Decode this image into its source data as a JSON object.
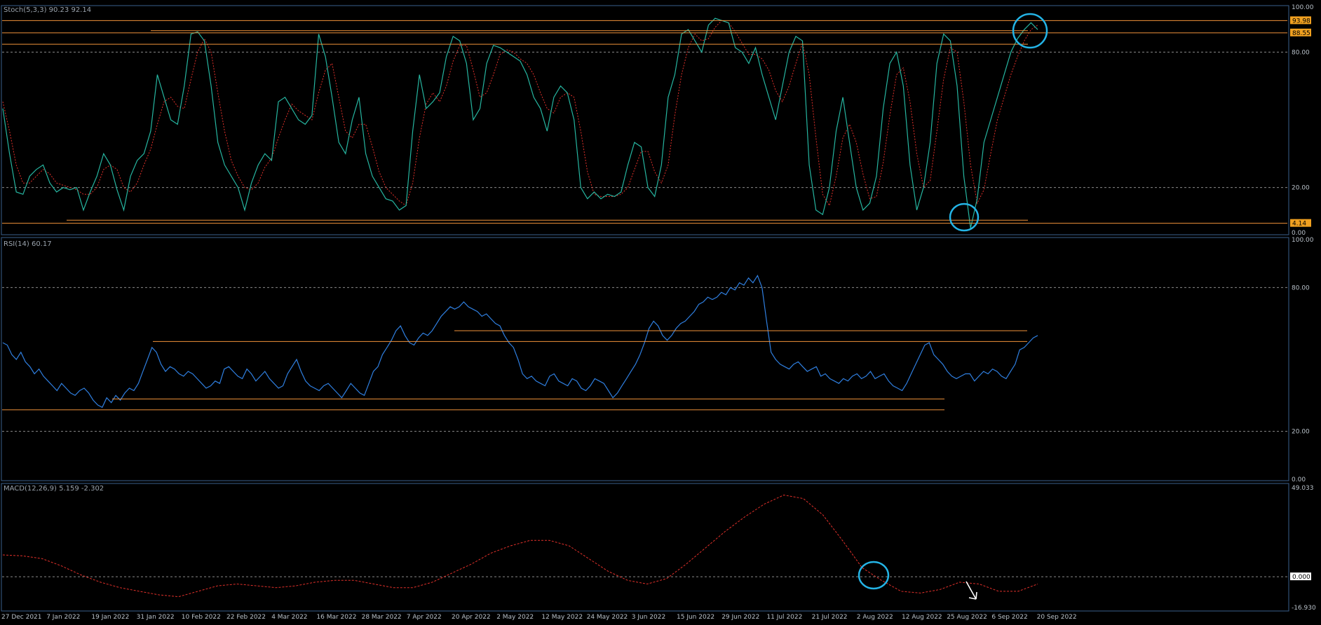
{
  "colors": {
    "background": "#000000",
    "panel_border": "#3a5f8c",
    "grid": "#8a8a8a",
    "stoch_main": "#26b5a0",
    "stoch_signal": "#e0302a",
    "rsi": "#2f7fe0",
    "macd_signal": "#e0302a",
    "level_line": "#f0923a",
    "highlight": "#24b4e6",
    "arrow": "#ffffff",
    "label_text": "#b8c0c8",
    "price_tag_bg": "#f0a020"
  },
  "x_axis": {
    "labels": [
      "27 Dec 2021",
      "7 Jan 2022",
      "19 Jan 2022",
      "31 Jan 2022",
      "10 Feb 2022",
      "22 Feb 2022",
      "4 Mar 2022",
      "16 Mar 2022",
      "28 Mar 2022",
      "7 Apr 2022",
      "20 Apr 2022",
      "2 May 2022",
      "12 May 2022",
      "24 May 2022",
      "3 Jun 2022",
      "15 Jun 2022",
      "29 Jun 2022",
      "11 Jul 2022",
      "21 Jul 2022",
      "2 Aug 2022",
      "12 Aug 2022",
      "25 Aug 2022",
      "6 Sep 2022",
      "20 Sep 2022"
    ]
  },
  "chart_data": [
    {
      "type": "line",
      "name": "stoch",
      "header": "Stoch(5,3,3) 90.23 92.14",
      "ylim": [
        0,
        100
      ],
      "y_ticks": [
        "100.00",
        "80.00",
        "20.00",
        "0.00"
      ],
      "levels": [
        80,
        20
      ],
      "price_tags": [
        "93.98",
        "88.55",
        "4.14"
      ],
      "series": [
        {
          "values": [
            55,
            35,
            18,
            17,
            25,
            28,
            30,
            22,
            18,
            20,
            19,
            20,
            10,
            18,
            25,
            35,
            30,
            19,
            10,
            25,
            32,
            35,
            45,
            70,
            60,
            50,
            48,
            65,
            88,
            89,
            85,
            65,
            40,
            30,
            25,
            20,
            10,
            22,
            30,
            35,
            32,
            58,
            60,
            55,
            50,
            48,
            52,
            88,
            78,
            60,
            40,
            35,
            50,
            60,
            35,
            25,
            20,
            15,
            14,
            10,
            12,
            45,
            70,
            55,
            58,
            62,
            78,
            87,
            85,
            75,
            50,
            55,
            75,
            83,
            82,
            80,
            78,
            76,
            70,
            60,
            55,
            45,
            60,
            65,
            62,
            50,
            20,
            15,
            18,
            15,
            17,
            16,
            18,
            30,
            40,
            38,
            20,
            16,
            30,
            60,
            70,
            88,
            90,
            85,
            80,
            92,
            95,
            94,
            93,
            82,
            80,
            75,
            82,
            70,
            60,
            50,
            65,
            80,
            87,
            85,
            30,
            10,
            8,
            20,
            45,
            60,
            40,
            20,
            10,
            13,
            25,
            55,
            75,
            80,
            65,
            30,
            10,
            20,
            40,
            75,
            88,
            85,
            65,
            25,
            2,
            15,
            40,
            50,
            60,
            70,
            80,
            86,
            90,
            93,
            90
          ]
        },
        {
          "values": [
            58,
            45,
            30,
            22,
            22,
            25,
            28,
            26,
            22,
            21,
            20,
            19,
            17,
            17,
            20,
            28,
            30,
            28,
            20,
            18,
            22,
            30,
            37,
            48,
            58,
            60,
            56,
            55,
            68,
            80,
            86,
            80,
            62,
            45,
            32,
            25,
            20,
            19,
            22,
            29,
            33,
            42,
            50,
            57,
            54,
            52,
            50,
            62,
            72,
            75,
            60,
            45,
            42,
            48,
            48,
            38,
            27,
            20,
            17,
            14,
            12,
            22,
            42,
            57,
            62,
            58,
            65,
            76,
            83,
            83,
            72,
            60,
            62,
            70,
            79,
            81,
            80,
            77,
            75,
            70,
            62,
            55,
            53,
            60,
            62,
            60,
            45,
            27,
            17,
            16,
            16,
            16,
            17,
            20,
            28,
            36,
            36,
            27,
            22,
            30,
            52,
            70,
            82,
            88,
            85,
            86,
            91,
            94,
            93,
            89,
            84,
            79,
            79,
            77,
            72,
            63,
            58,
            65,
            75,
            84,
            70,
            42,
            17,
            12,
            25,
            42,
            48,
            40,
            26,
            15,
            16,
            31,
            52,
            70,
            73,
            58,
            35,
            20,
            23,
            45,
            68,
            82,
            80,
            58,
            30,
            13,
            19,
            35,
            50,
            60,
            70,
            78,
            85,
            90,
            92
          ]
        }
      ]
    },
    {
      "type": "line",
      "name": "rsi",
      "header": "RSI(14) 60.17",
      "ylim": [
        0,
        100
      ],
      "y_ticks": [
        "100.00",
        "80.00",
        "20.00",
        "0.00"
      ],
      "levels": [
        80,
        20
      ],
      "series": [
        {
          "values": [
            57,
            56,
            52,
            50,
            53,
            49,
            47,
            44,
            46,
            43,
            41,
            39,
            37,
            40,
            38,
            36,
            35,
            37,
            38,
            36,
            33,
            31,
            30,
            34,
            32,
            35,
            33,
            36,
            38,
            37,
            40,
            45,
            50,
            55,
            53,
            48,
            45,
            47,
            46,
            44,
            43,
            45,
            44,
            42,
            40,
            38,
            39,
            41,
            40,
            46,
            47,
            45,
            43,
            42,
            46,
            44,
            41,
            43,
            45,
            42,
            40,
            38,
            39,
            44,
            47,
            50,
            45,
            41,
            39,
            38,
            37,
            39,
            40,
            38,
            36,
            34,
            37,
            40,
            38,
            36,
            35,
            40,
            45,
            47,
            52,
            55,
            58,
            62,
            64,
            60,
            57,
            56,
            59,
            61,
            60,
            62,
            65,
            68,
            70,
            72,
            71,
            72,
            74,
            72,
            71,
            70,
            68,
            69,
            67,
            65,
            64,
            60,
            57,
            55,
            50,
            44,
            42,
            43,
            41,
            40,
            39,
            43,
            44,
            41,
            40,
            39,
            42,
            41,
            38,
            37,
            39,
            42,
            41,
            40,
            37,
            34,
            36,
            39,
            42,
            45,
            48,
            52,
            57,
            63,
            66,
            64,
            60,
            58,
            60,
            63,
            65,
            66,
            68,
            70,
            73,
            74,
            76,
            75,
            76,
            78,
            77,
            80,
            79,
            82,
            81,
            84,
            82,
            85,
            80,
            66,
            53,
            50,
            48,
            47,
            46,
            48,
            49,
            47,
            45,
            46,
            47,
            43,
            44,
            42,
            41,
            40,
            42,
            41,
            43,
            44,
            42,
            43,
            45,
            42,
            43,
            44,
            41,
            39,
            38,
            37,
            40,
            44,
            48,
            52,
            56,
            57,
            52,
            50,
            48,
            45,
            43,
            42,
            43,
            44,
            44,
            41,
            43,
            45,
            44,
            46,
            45,
            43,
            42,
            45,
            48,
            54,
            55,
            57,
            59,
            60
          ]
        }
      ],
      "levels_drawn": [
        62,
        60,
        36,
        32
      ]
    },
    {
      "type": "line",
      "name": "macd",
      "header": "MACD(12,26,9) 5.159 -2.302",
      "ylim": [
        -16.93,
        49.033
      ],
      "y_ticks": [
        "49.033",
        "0.000",
        "-16.930"
      ],
      "levels": [
        0
      ],
      "series": [
        {
          "values": [
            12,
            11.5,
            10,
            6,
            1,
            -3,
            -6,
            -8,
            -10,
            -11,
            -8,
            -5,
            -4,
            -5,
            -6,
            -5,
            -3,
            -2,
            -2,
            -4,
            -6,
            -6,
            -3,
            2,
            7,
            13,
            17,
            20,
            20,
            17,
            10,
            3,
            -2,
            -4,
            -1,
            7,
            16,
            25,
            33,
            40,
            45,
            43,
            34,
            20,
            5,
            -2,
            -8,
            -9,
            -7,
            -3,
            -4,
            -8,
            -8,
            -4
          ]
        }
      ]
    }
  ]
}
